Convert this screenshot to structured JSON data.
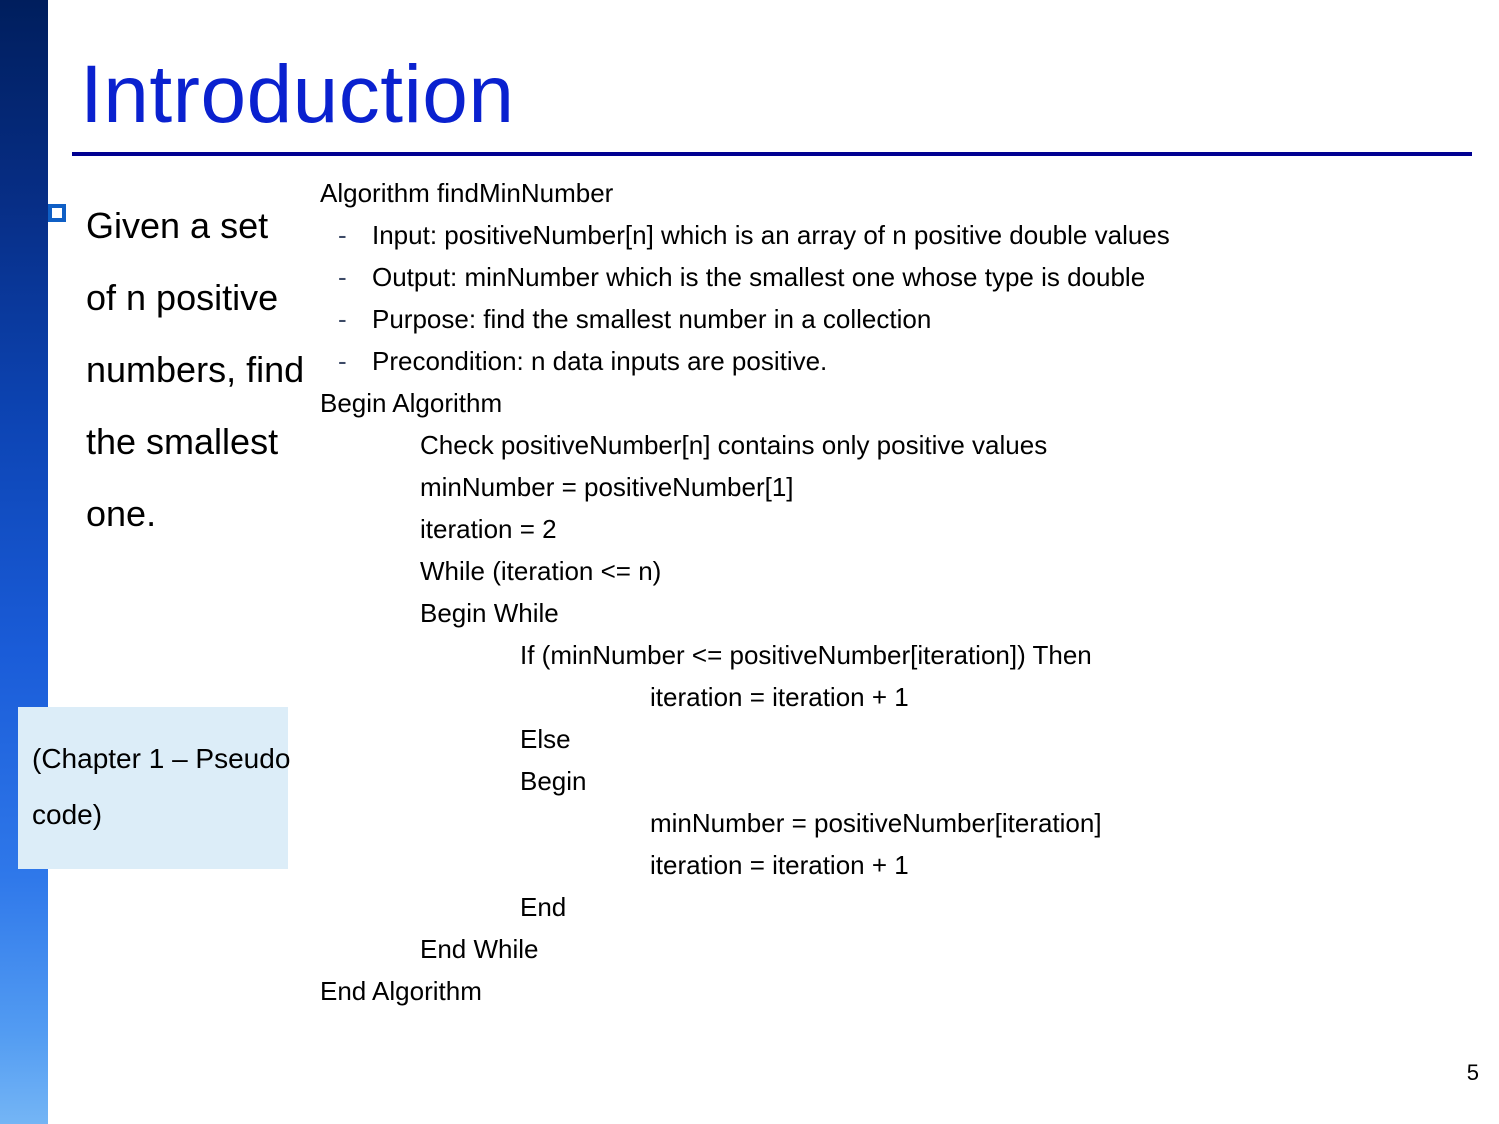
{
  "title": "Introduction",
  "bullet": {
    "text": "Given a set of n positive numbers, find the smallest one."
  },
  "chapter_note": "(Chapter 1 – Pseudo code)",
  "page_number": "5",
  "code": {
    "header": "Algorithm findMinNumber",
    "meta": [
      "Input: positiveNumber[n] which is an array of n positive double values",
      "Output: minNumber which is the smallest one whose type is double",
      "Purpose: find the smallest number in a collection",
      "Precondition: n data inputs are positive."
    ],
    "body": {
      "begin": "Begin Algorithm",
      "lines1": [
        "Check positiveNumber[n] contains only positive values",
        "minNumber = positiveNumber[1]",
        "iteration = 2",
        "While (iteration <= n)",
        "Begin While"
      ],
      "if_line": "If (minNumber <= positiveNumber[iteration]) Then",
      "then_line": "iteration = iteration + 1",
      "else_line": "Else",
      "begin2": "Begin",
      "inner": [
        "minNumber = positiveNumber[iteration]",
        "iteration = iteration + 1"
      ],
      "end_inner": "End",
      "end_while": "End While",
      "end_algo": "End Algorithm"
    }
  },
  "chart_data": null
}
